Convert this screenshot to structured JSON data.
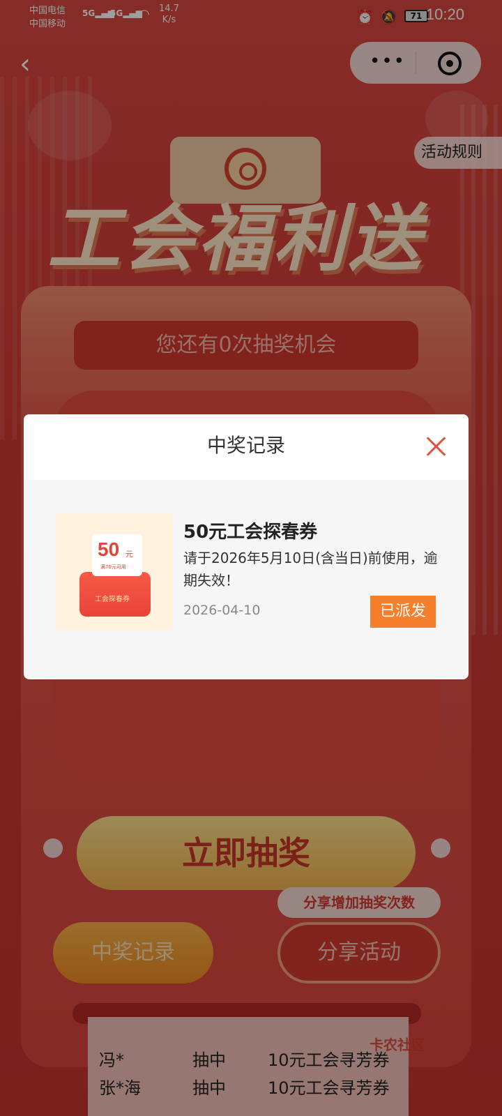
{
  "status_bar": {
    "carrier_1": "中国电信",
    "carrier_2": "中国移动",
    "sig1": "5G",
    "sig2": "5G",
    "net_speed": "14.7",
    "net_unit": "K/s",
    "battery": "71",
    "time": "10:20"
  },
  "nav": {
    "back_icon": "chevron-left-icon",
    "more_icon": "more-dots-icon",
    "close_icon": "target-icon"
  },
  "page": {
    "rules_label": "活动规则",
    "hero_title": "工会福利送",
    "chances_text": "您还有0次抽奖机会",
    "draw_button": "立即抽奖",
    "share_tip": "分享增加抽奖次数",
    "records_button": "中奖记录",
    "share_button": "分享活动",
    "winners": [
      {
        "name": "冯*",
        "action": "抽中",
        "prize": "10元工会寻芳券"
      },
      {
        "name": "张*海",
        "action": "抽中",
        "prize": "10元工会寻芳券"
      }
    ],
    "watermark": "卡农社区"
  },
  "modal": {
    "title": "中奖记录",
    "prize": {
      "image_amount": "50",
      "image_unit": "元",
      "image_sub": "满70元可用",
      "image_label": "工会探春券",
      "name": "50元工会探春券",
      "desc": "请于2026年5月10日(含当日)前使用，逾期失效！",
      "date": "2026-04-10",
      "status": "已派发"
    }
  },
  "colors": {
    "primary_red": "#d9443c",
    "status_orange": "#f57f2c",
    "close_red": "#e3523f"
  }
}
